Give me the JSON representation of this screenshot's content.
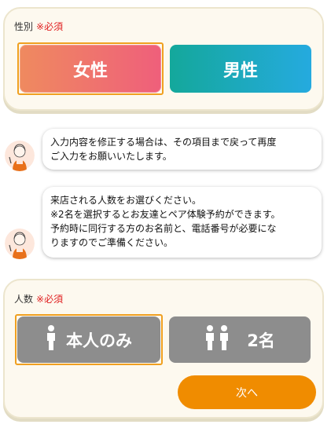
{
  "gender_section": {
    "label": "性別",
    "required": "※必須",
    "options": [
      {
        "label": "女性",
        "selected": true
      },
      {
        "label": "男性",
        "selected": false
      }
    ]
  },
  "messages": [
    {
      "lines": [
        "入力内容を修正する場合は、その項目まで戻って再度",
        "ご入力をお願いいたします。"
      ]
    },
    {
      "lines": [
        "来店される人数をお選びください。",
        "※2名を選択するとお友達とペア体験予約ができます。",
        "予約時に同行する方のお名前と、電話番号が必要にな",
        "りますのでご準備ください。"
      ]
    }
  ],
  "people_section": {
    "label": "人数",
    "required": "※必須",
    "options": [
      {
        "label": "本人のみ",
        "icon": "single-person-icon",
        "selected": true
      },
      {
        "label": "2名",
        "icon": "two-people-icon",
        "selected": false
      }
    ],
    "next_label": "次へ"
  },
  "colors": {
    "female_gradient": [
      "#ef8a5f",
      "#ef5f7b"
    ],
    "male_gradient": [
      "#14a89b",
      "#25aadf"
    ],
    "selection_border": "#f0a020",
    "next_button": "#f08c00",
    "required_text": "#e02020",
    "card_background": "#fdf9ef"
  }
}
